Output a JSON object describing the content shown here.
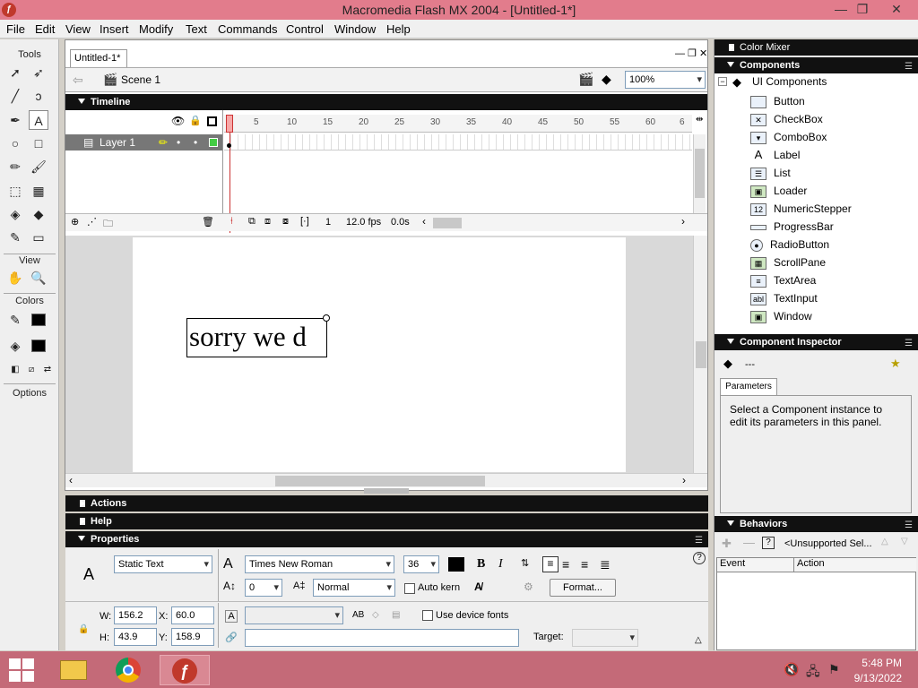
{
  "window": {
    "title": "Macromedia Flash MX 2004 - [Untitled-1*]",
    "minimize": "—",
    "restore": "❐",
    "close": "✕"
  },
  "menu": [
    "File",
    "Edit",
    "View",
    "Insert",
    "Modify",
    "Text",
    "Commands",
    "Control",
    "Window",
    "Help"
  ],
  "tools": {
    "header": "Tools",
    "view_header": "View",
    "colors_header": "Colors",
    "options_header": "Options"
  },
  "document": {
    "tab": "Untitled-1*",
    "scene": "Scene 1",
    "zoom": "100%"
  },
  "timeline": {
    "header": "Timeline",
    "ruler_ticks": [
      "5",
      "10",
      "15",
      "20",
      "25",
      "30",
      "35",
      "40",
      "45",
      "50",
      "55",
      "60",
      "6"
    ],
    "layer_name": "Layer 1",
    "current_frame": "1",
    "fps": "12.0 fps",
    "elapsed": "0.0s"
  },
  "stage": {
    "text": "sorry we d"
  },
  "panels": {
    "actions": "Actions",
    "help": "Help",
    "properties": "Properties"
  },
  "properties": {
    "text_type": "Static Text",
    "font": "Times New Roman",
    "size": "36",
    "bold": "B",
    "italic": "I",
    "spacing": "0",
    "baseline": "Normal",
    "auto_kern": "Auto kern",
    "format_button": "Format...",
    "use_device_fonts": "Use device fonts",
    "target_label": "Target:",
    "w_label": "W:",
    "w_value": "156.2",
    "h_label": "H:",
    "h_value": "43.9",
    "x_label": "X:",
    "x_value": "60.0",
    "y_label": "Y:",
    "y_value": "158.9",
    "help_icon": "?"
  },
  "right": {
    "color_mixer": "Color Mixer",
    "components": "Components",
    "ui_components": "UI Components",
    "component_items": [
      "Button",
      "CheckBox",
      "ComboBox",
      "Label",
      "List",
      "Loader",
      "NumericStepper",
      "ProgressBar",
      "RadioButton",
      "ScrollPane",
      "TextArea",
      "TextInput",
      "Window"
    ],
    "component_inspector": "Component Inspector",
    "inspector_dash": "---",
    "parameters_tab": "Parameters",
    "inspector_msg": "Select a Component instance to edit its parameters in this panel.",
    "behaviors": "Behaviors",
    "unsupported": "<Unsupported Sel...",
    "event_col": "Event",
    "action_col": "Action"
  },
  "taskbar": {
    "time": "5:48 PM",
    "date": "9/13/2022"
  }
}
